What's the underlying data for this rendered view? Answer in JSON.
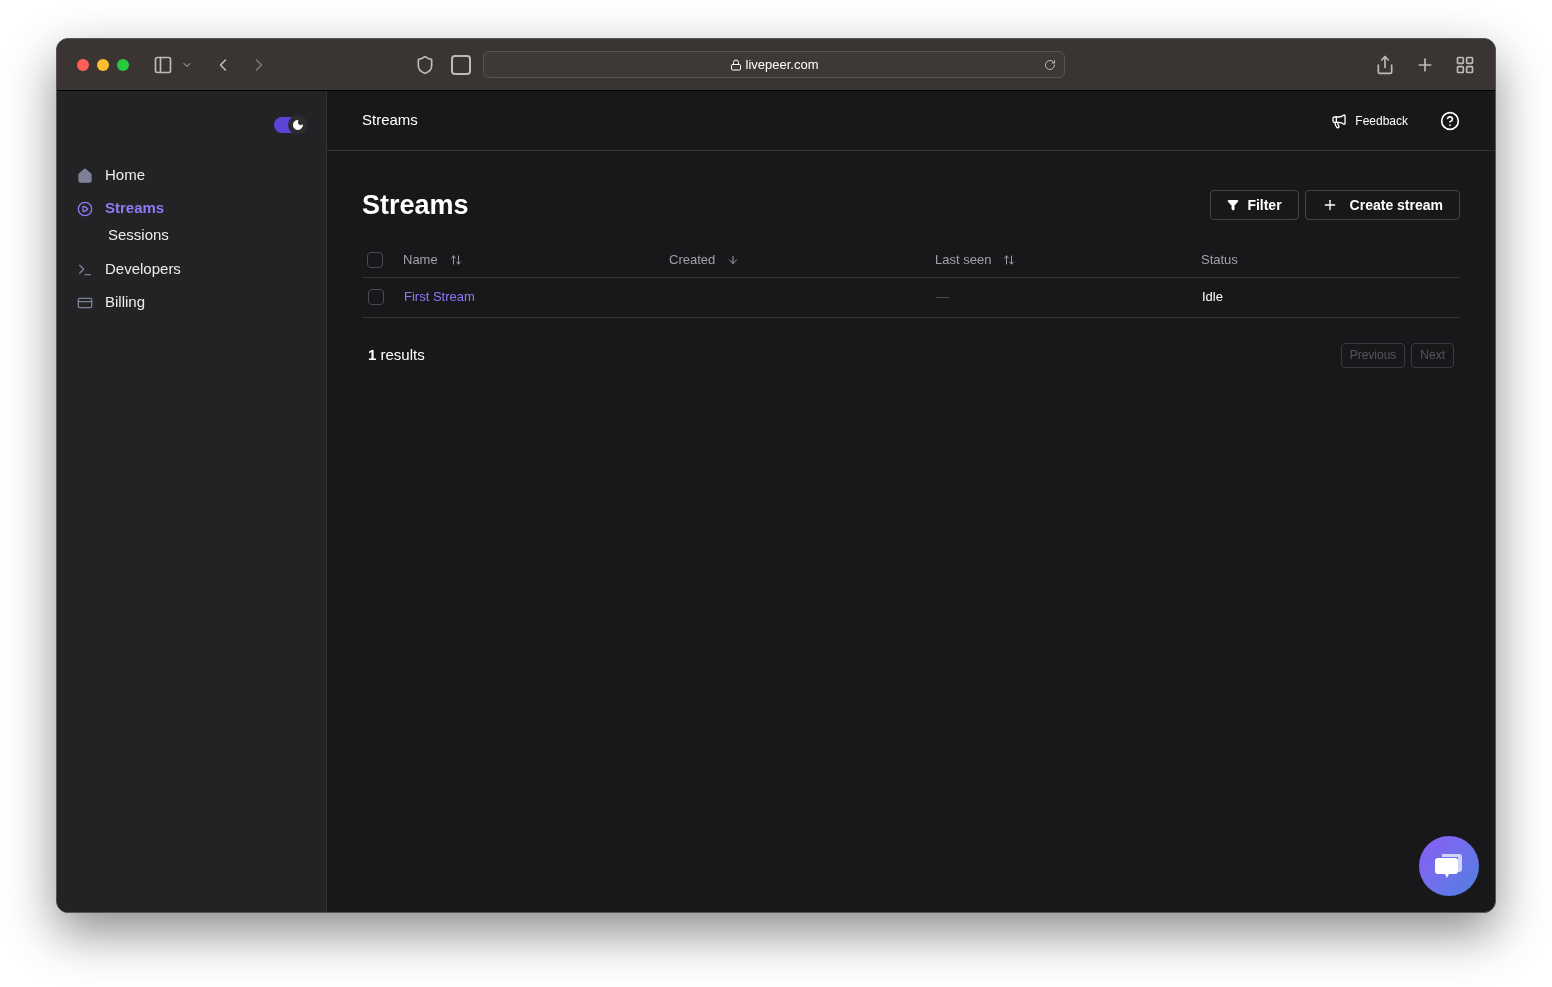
{
  "browser": {
    "url": "livepeer.com"
  },
  "sidebar": {
    "theme_toggle": {
      "on": true
    },
    "items": [
      {
        "label": "Home",
        "selected": false
      },
      {
        "label": "Streams",
        "selected": true,
        "children": [
          {
            "label": "Sessions",
            "selected": false
          }
        ]
      },
      {
        "label": "Developers",
        "selected": false
      },
      {
        "label": "Billing",
        "selected": false
      }
    ]
  },
  "header": {
    "title": "Streams",
    "feedback": "Feedback"
  },
  "page": {
    "title": "Streams",
    "filter_button": "Filter",
    "create_button": "Create stream"
  },
  "table": {
    "select_all": {
      "checked": false
    },
    "columns": [
      {
        "label": "Name",
        "kind": "sortable"
      },
      {
        "label": "Created",
        "kind": "sorted"
      },
      {
        "label": "Last seen",
        "kind": "sortable"
      },
      {
        "label": "Status",
        "kind": "plain"
      }
    ],
    "rows": [
      {
        "checked": false,
        "name": "First Stream",
        "last_seen": "—",
        "status": "Idle"
      }
    ]
  },
  "footer": {
    "results": "**1** results",
    "previous": {
      "label": "Previous",
      "disabled": true
    },
    "next": {
      "label": "Next",
      "disabled": true
    }
  }
}
